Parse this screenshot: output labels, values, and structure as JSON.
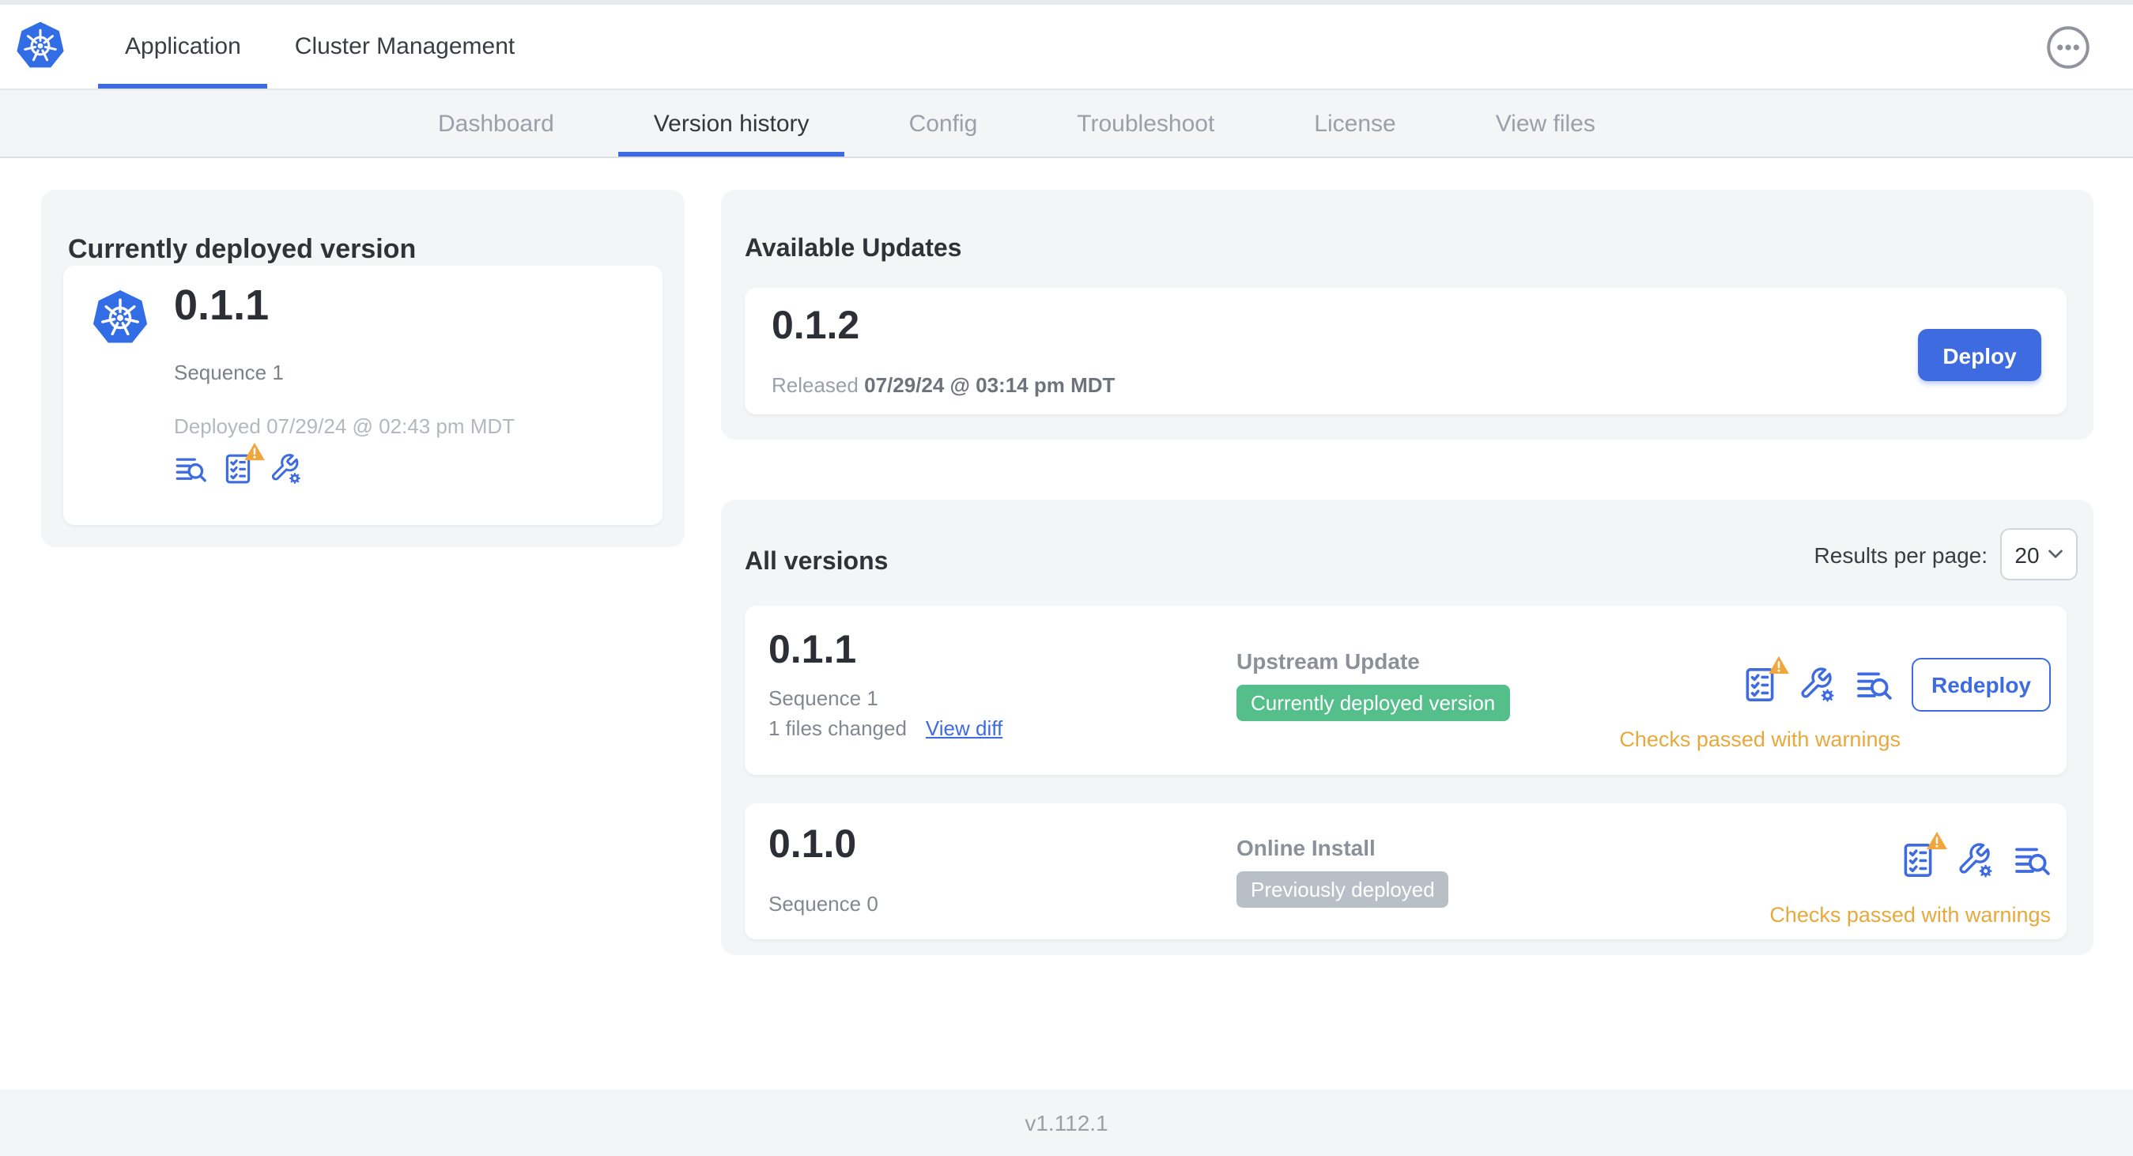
{
  "header": {
    "logo": "kubernetes-logo",
    "tabs": [
      {
        "label": "Application",
        "active": true
      },
      {
        "label": "Cluster Management",
        "active": false
      }
    ],
    "menu_icon": "ellipsis-menu-icon"
  },
  "subnav": {
    "tabs": [
      {
        "label": "Dashboard",
        "active": false
      },
      {
        "label": "Version history",
        "active": true
      },
      {
        "label": "Config",
        "active": false
      },
      {
        "label": "Troubleshoot",
        "active": false
      },
      {
        "label": "License",
        "active": false
      },
      {
        "label": "View files",
        "active": false
      }
    ]
  },
  "deployed_card": {
    "title": "Currently deployed version",
    "version": "0.1.1",
    "sequence": "Sequence 1",
    "deployed_at": "Deployed 07/29/24 @ 02:43 pm MDT",
    "icons": [
      "diff-icon",
      "preflight-checks-warning-icon",
      "config-icon"
    ]
  },
  "available_updates": {
    "title": "Available Updates",
    "version": "0.1.2",
    "released_label": "Released",
    "released_at": "07/29/24 @ 03:14 pm MDT",
    "deploy_button": "Deploy"
  },
  "all_versions": {
    "title": "All versions",
    "results_per_page_label": "Results per page:",
    "results_per_page": "20",
    "rows": [
      {
        "version": "0.1.1",
        "sequence": "Sequence 1",
        "files_changed": "1 files changed",
        "view_diff_link": "View diff",
        "source": "Upstream Update",
        "badge": {
          "label": "Currently deployed version",
          "color": "#54bf8b"
        },
        "icons": [
          "preflight-checks-warning-icon",
          "config-icon",
          "diff-icon"
        ],
        "action_button": "Redeploy",
        "status": "Checks passed with warnings"
      },
      {
        "version": "0.1.0",
        "sequence": "Sequence 0",
        "source": "Online Install",
        "badge": {
          "label": "Previously deployed",
          "color": "#b9bfc6"
        },
        "icons": [
          "preflight-checks-warning-icon",
          "config-icon",
          "diff-icon"
        ],
        "status": "Checks passed with warnings"
      }
    ]
  },
  "footer": {
    "version": "v1.112.1"
  },
  "colors": {
    "accent_blue": "#3e6bdf",
    "k8s_blue": "#326de6",
    "green_badge": "#54bf8b",
    "gray_badge": "#b9bfc6",
    "warning_orange": "#e7a93c",
    "card_bg": "#f4f5f7"
  }
}
